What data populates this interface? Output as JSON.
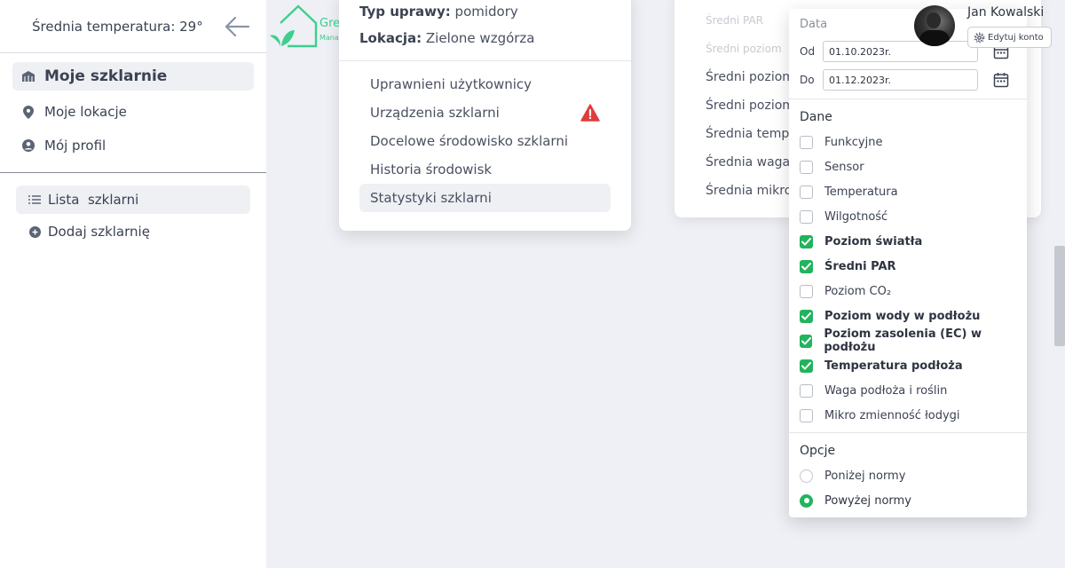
{
  "sidebar": {
    "avg_temp": "Średnia temperatura: 29°",
    "nav": [
      {
        "label": "Moje szklarnie"
      },
      {
        "label": "Moje lokacje"
      },
      {
        "label": "Mój profil"
      }
    ],
    "sub": [
      {
        "label": "Lista  szklarni"
      },
      {
        "label": "Dodaj szklarnię"
      }
    ]
  },
  "logo": {
    "text": "Gre",
    "subtext": "Mana"
  },
  "greenhouse": {
    "crop_label": "Typ uprawy:",
    "crop_value": "pomidory",
    "location_label": "Lokacja:",
    "location_value": "Zielone wzgórza",
    "links": [
      {
        "label": "Uprawnieni użytkownicy"
      },
      {
        "label": "Urządzenia szklarni",
        "alert": true
      },
      {
        "label": "Docelowe środowisko szklarni"
      },
      {
        "label": "Historia środowisk"
      },
      {
        "label": "Statystyki szklarni"
      }
    ]
  },
  "stats_bg": {
    "items": [
      "Średni PAR",
      "Średni poziom",
      "Średni poziom",
      "Średni poziom",
      "Średnia tempe",
      "Średnia waga p",
      "Średnia mikro z"
    ]
  },
  "user": {
    "name": "Jan Kowalski",
    "edit_label": "Edytuj konto"
  },
  "filter": {
    "date_header": "Data",
    "from_label": "Od",
    "from_value": "01.10.2023r.",
    "to_label": "Do",
    "to_value": "01.12.2023r.",
    "data_header": "Dane",
    "options": [
      {
        "label": "Funkcyjne",
        "checked": false
      },
      {
        "label": "Sensor",
        "checked": false
      },
      {
        "label": "Temperatura",
        "checked": false
      },
      {
        "label": "Wilgotność",
        "checked": false
      },
      {
        "label": "Poziom światła",
        "checked": true
      },
      {
        "label": "Średni PAR",
        "checked": true
      },
      {
        "label": "Poziom CO₂",
        "checked": false
      },
      {
        "label": "Poziom wody w podłożu",
        "checked": true
      },
      {
        "label": "Poziom zasolenia (EC) w podłożu",
        "checked": true
      },
      {
        "label": "Temperatura podłoża",
        "checked": true
      },
      {
        "label": "Waga podłoża i roślin",
        "checked": false
      },
      {
        "label": "Mikro zmienność łodygi",
        "checked": false
      }
    ],
    "options_header": "Opcje",
    "radios": [
      {
        "label": "Poniżej normy",
        "selected": false
      },
      {
        "label": "Powyżej normy",
        "selected": true
      }
    ]
  },
  "colors": {
    "accent": "#22b35e",
    "logo": "#3ecf8e",
    "alert": "#e03c3c"
  }
}
